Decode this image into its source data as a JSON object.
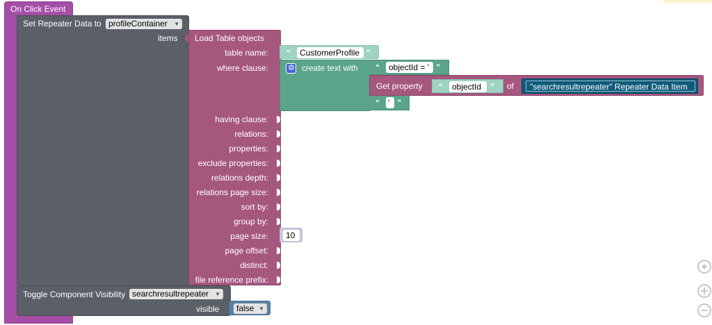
{
  "event": {
    "title": "On Click Event"
  },
  "set_repeater": {
    "label": "Set Repeater Data to",
    "target": "profileContainer",
    "items_label": "items"
  },
  "load_table": {
    "title": "Load Table objects",
    "params": [
      "table name:",
      "where clause:",
      "having clause:",
      "relations:",
      "properties:",
      "exclude properties:",
      "relations depth:",
      "relations page size:",
      "sort by:",
      "group by:",
      "page size:",
      "page offset:",
      "distinct:",
      "file reference prefix:"
    ],
    "table_name_value": "CustomerProfile",
    "page_size_value": "10"
  },
  "create_text": {
    "label": "create text with",
    "part1": "objectId = '",
    "part3": "'"
  },
  "get_property": {
    "label": "Get property",
    "property": "objectId",
    "of_label": "of",
    "source": "\"searchresultrepeater\" Repeater Data Item"
  },
  "toggle": {
    "label": "Toggle Component Visibility",
    "component": "searchresultrepeater",
    "visible_label": "visible",
    "visible_value": "false"
  },
  "icons": {
    "dropdown": "chevron-down-icon",
    "quote_open": "“",
    "quote_close": "”",
    "gear": "gear-icon"
  },
  "colors": {
    "event": "#a44ea8",
    "set_repeater": "#5b5f67",
    "load_table": "#a5577e",
    "text": "#9fd3c3",
    "create_text": "#5ba58a",
    "repeater_item": "#0e5b7a",
    "number": "#c8cbe0",
    "boolean": "#5b80a5"
  }
}
